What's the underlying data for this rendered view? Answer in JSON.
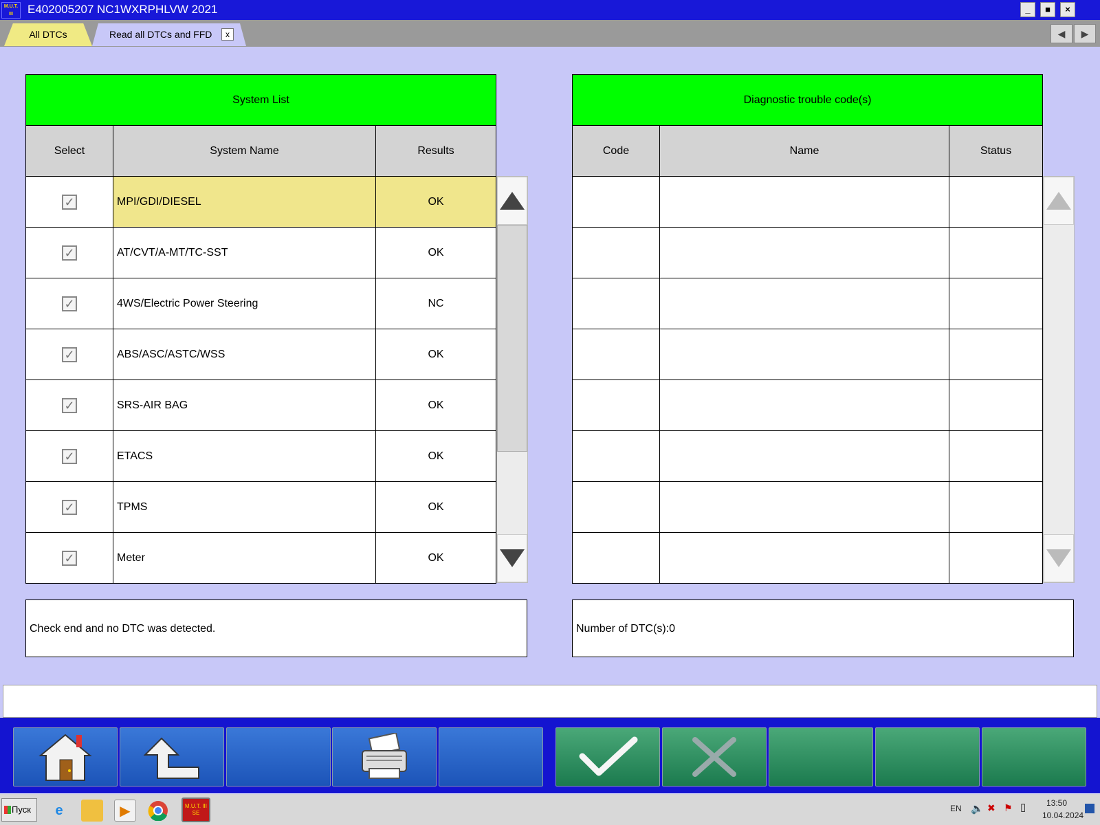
{
  "window": {
    "title_id": "E402005207",
    "title_vin": "NC1WXRPHLVW 2021",
    "app_icon_text": "M.U.T. III",
    "minimize": "_",
    "maximize": "■",
    "close": "×"
  },
  "tabs": [
    {
      "label": "All DTCs"
    },
    {
      "label": "Read all DTCs and FFD",
      "close": "x"
    }
  ],
  "tabnav": {
    "prev": "◀",
    "next": "▶"
  },
  "system_list": {
    "title": "System List",
    "columns": [
      "Select",
      "System Name",
      "Results"
    ],
    "rows": [
      {
        "name": "MPI/GDI/DIESEL",
        "result": "OK",
        "checked": true
      },
      {
        "name": "AT/CVT/A-MT/TC-SST",
        "result": "OK",
        "checked": true
      },
      {
        "name": "4WS/Electric Power Steering",
        "result": "NC",
        "checked": true
      },
      {
        "name": "ABS/ASC/ASTC/WSS",
        "result": "OK",
        "checked": true
      },
      {
        "name": "SRS-AIR BAG",
        "result": "OK",
        "checked": true
      },
      {
        "name": "ETACS",
        "result": "OK",
        "checked": true
      },
      {
        "name": "TPMS",
        "result": "OK",
        "checked": true
      },
      {
        "name": "Meter",
        "result": "OK",
        "checked": true
      }
    ],
    "message": "Check end and no DTC was detected."
  },
  "dtc_list": {
    "title": "Diagnostic trouble code(s)",
    "columns": [
      "Code",
      "Name",
      "Status"
    ],
    "message": "Number of DTC(s):0"
  },
  "taskbar": {
    "start_label": "Пуск",
    "lang": "EN",
    "time": "13:50",
    "date": "10.04.2024",
    "mut_icon_text": "M.U.T. III SE"
  },
  "colors": {
    "title_blue": "#1818d8",
    "header_green": "#00ff00",
    "highlight_row": "#f0e68c",
    "background": "#c8c8f8"
  }
}
